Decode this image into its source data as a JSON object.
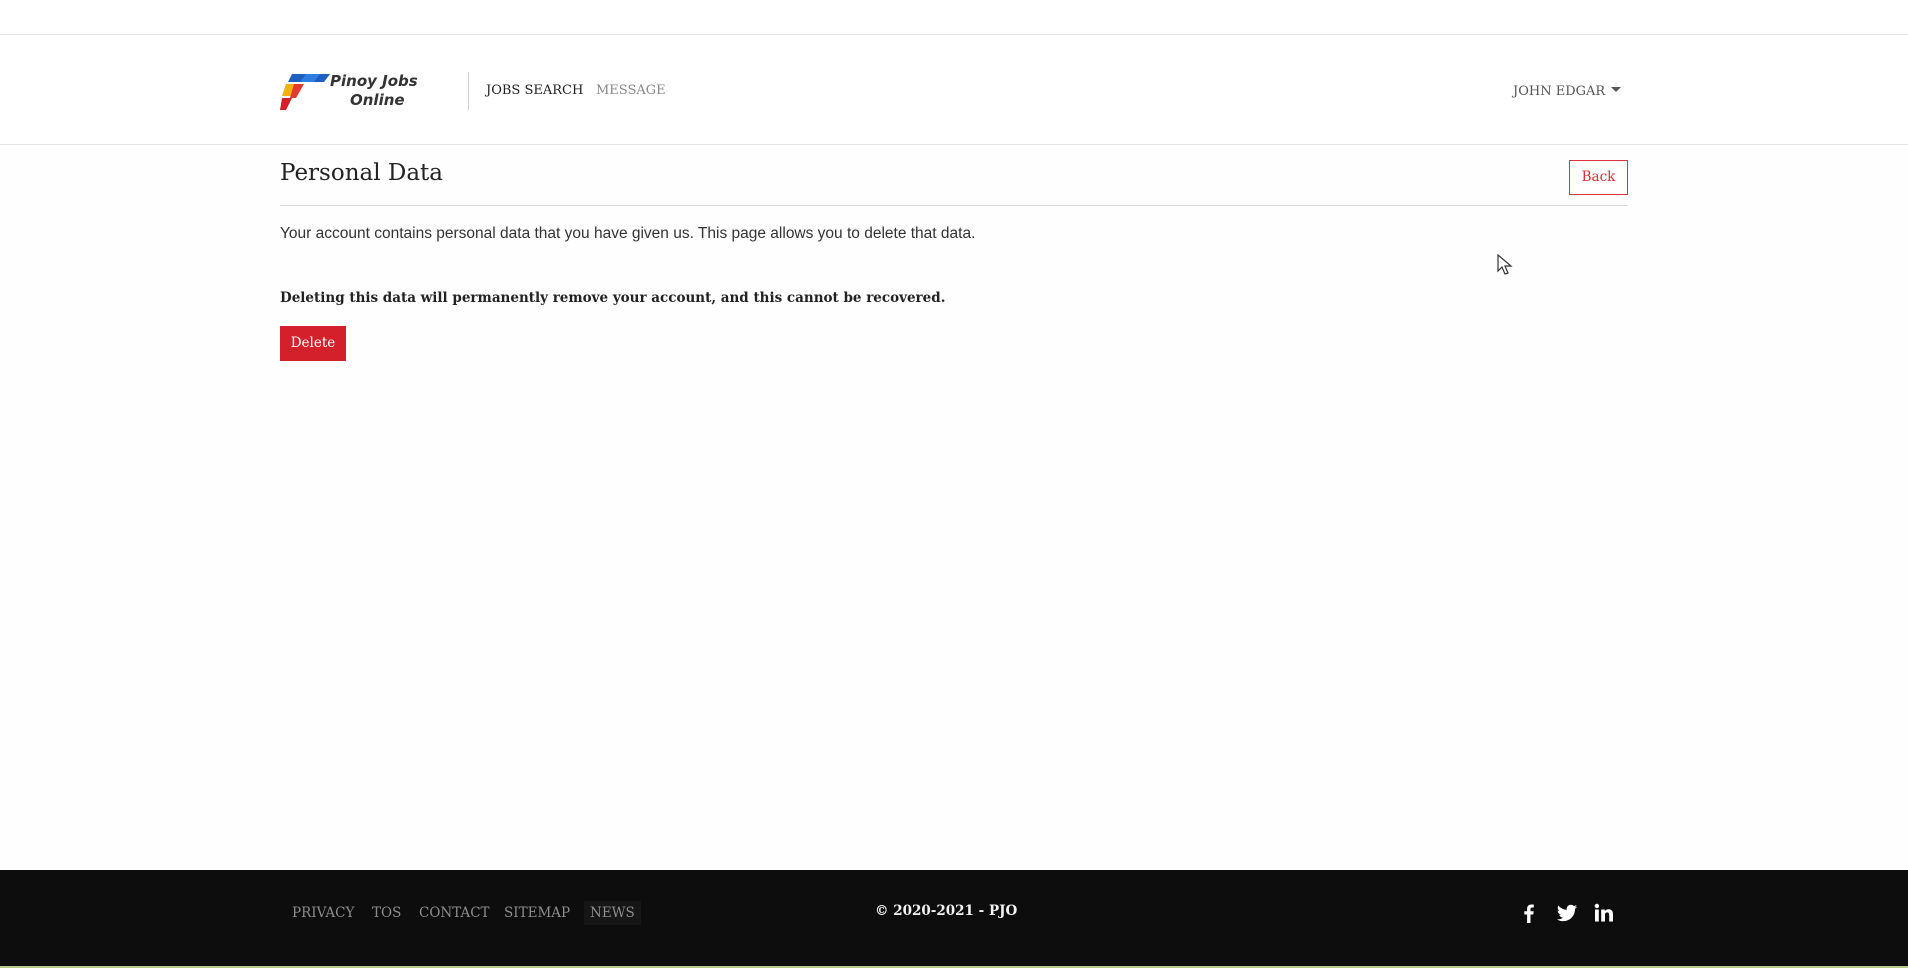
{
  "header": {
    "logo": {
      "line1": "Pinoy Jobs",
      "line2": "Online"
    },
    "nav": {
      "jobs_search": "JOBS SEARCH",
      "message": "MESSAGE"
    },
    "user_menu": {
      "label": "JOHN EDGAR"
    }
  },
  "main": {
    "title": "Personal Data",
    "back_label": "Back",
    "intro": "Your account contains personal data that you have given us. This page allows you to delete that data.",
    "warning": "Deleting this data will permanently remove your account, and this cannot be recovered.",
    "delete_label": "Delete"
  },
  "footer": {
    "links": [
      "PRIVACY",
      "TOS",
      "CONTACT",
      "SITEMAP",
      "NEWS"
    ],
    "copyright": "© 2020-2021 - PJO",
    "social_icons": [
      "facebook-icon",
      "twitter-icon",
      "linkedin-icon"
    ]
  },
  "colors": {
    "accent_red": "#d3202a",
    "footer_bg": "#0d0d0d"
  }
}
